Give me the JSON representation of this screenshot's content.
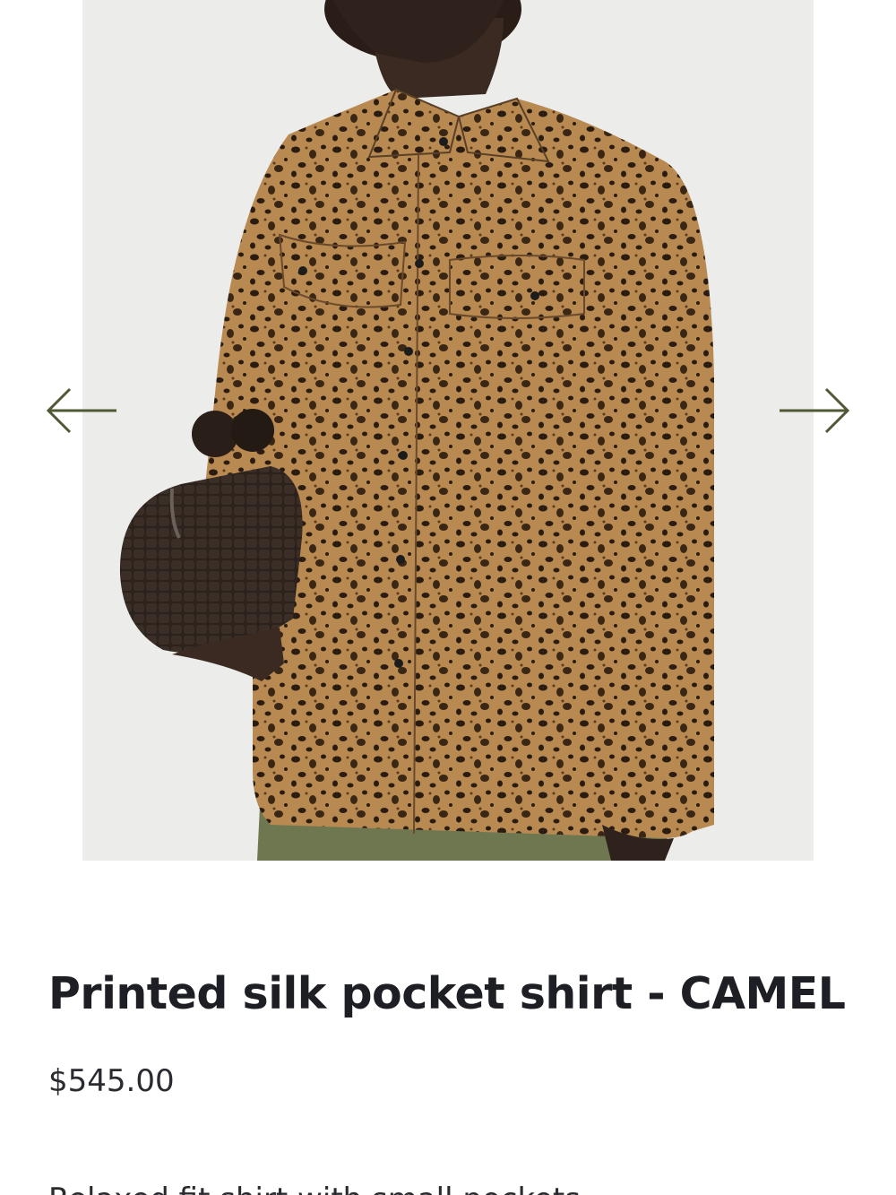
{
  "product": {
    "title": "Printed silk pocket shirt - CAMEL",
    "price": "$545.00",
    "description_partial": "Relaxed fit shirt with small pockets"
  },
  "gallery": {
    "prev_icon": "arrow-left-icon",
    "next_icon": "arrow-right-icon",
    "arrow_color": "#4f5a34"
  }
}
